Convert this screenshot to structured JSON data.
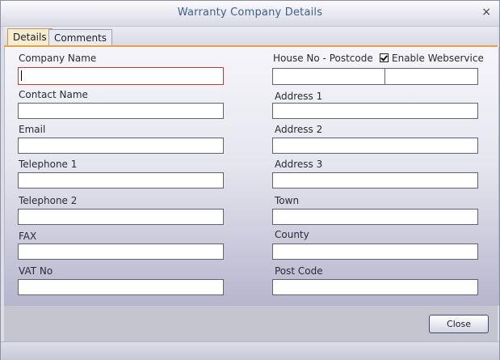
{
  "window": {
    "title": "Warranty Company Details",
    "close_glyph": "×"
  },
  "tabs": [
    {
      "label": "Details"
    },
    {
      "label": "Comments"
    }
  ],
  "left_fields": [
    {
      "label": "Company Name",
      "value": ""
    },
    {
      "label": "Contact Name",
      "value": ""
    },
    {
      "label": "Email",
      "value": ""
    },
    {
      "label": "Telephone 1",
      "value": ""
    },
    {
      "label": "Telephone 2",
      "value": ""
    },
    {
      "label": "FAX",
      "value": ""
    },
    {
      "label": "VAT No",
      "value": ""
    }
  ],
  "right_fields": [
    {
      "label": "House No - Postcode",
      "value": ""
    },
    {
      "label": "Address 1",
      "value": ""
    },
    {
      "label": "Address 2",
      "value": ""
    },
    {
      "label": "Address 3",
      "value": ""
    },
    {
      "label": "Town",
      "value": ""
    },
    {
      "label": "County",
      "value": ""
    },
    {
      "label": "Post Code",
      "value": ""
    }
  ],
  "enable_webservice": {
    "label": "Enable Webservice",
    "checked": true
  },
  "footer": {
    "close_label": "Close"
  }
}
